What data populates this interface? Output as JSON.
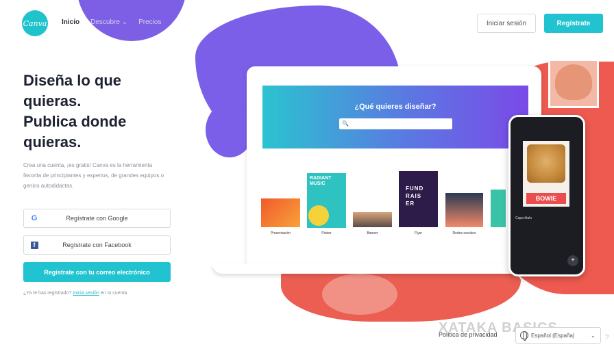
{
  "header": {
    "logo_text": "Canva",
    "nav": [
      {
        "label": "Inicio"
      },
      {
        "label": "Descubre ⌄"
      },
      {
        "label": "Precios"
      }
    ],
    "login_label": "Iniciar sesión",
    "signup_label": "Regístrate"
  },
  "hero": {
    "title": "Diseña lo que\nquieras.\nPublica donde\nquieras.",
    "description": "Crea una cuenta, ¡es gratis! Canva es la herramienta favorita de principiantes y expertos, de grandes equipos o genios autodidactas.",
    "google_label": "Regístrate con Google",
    "facebook_label": "Regístrate con Facebook",
    "email_label": "Regístrate con tu correo electrónico",
    "already_prefix": "¿Ya te has registrado?",
    "already_link": "Inicia sesión",
    "already_suffix": "en tu cuenta"
  },
  "mockup": {
    "banner_title": "¿Qué quieres diseñar?",
    "search_icon": "🔍",
    "categories": [
      {
        "label": "Presentación"
      },
      {
        "label": "Póster"
      },
      {
        "label": "Banner"
      },
      {
        "label": "Flyer"
      },
      {
        "label": "Redes sociales"
      }
    ],
    "poster_text": "RADIANT MUSIC",
    "flyer_text": "FUND\nRAIS\nER",
    "phone_name": "BOWIE",
    "phone_layer": "Capa título"
  },
  "footer": {
    "watermark": "XATAKA BASICS",
    "privacy": "Política de privacidad",
    "language": "Español (España)",
    "help_symbol": "?"
  },
  "colors": {
    "accent": "#22c3d0",
    "purple": "#7b5fe8",
    "red": "#ee5a4f"
  },
  "icons": {
    "globe": "globe-icon",
    "chevron": "chevron-down-icon",
    "google": "google-icon",
    "facebook": "facebook-icon"
  }
}
